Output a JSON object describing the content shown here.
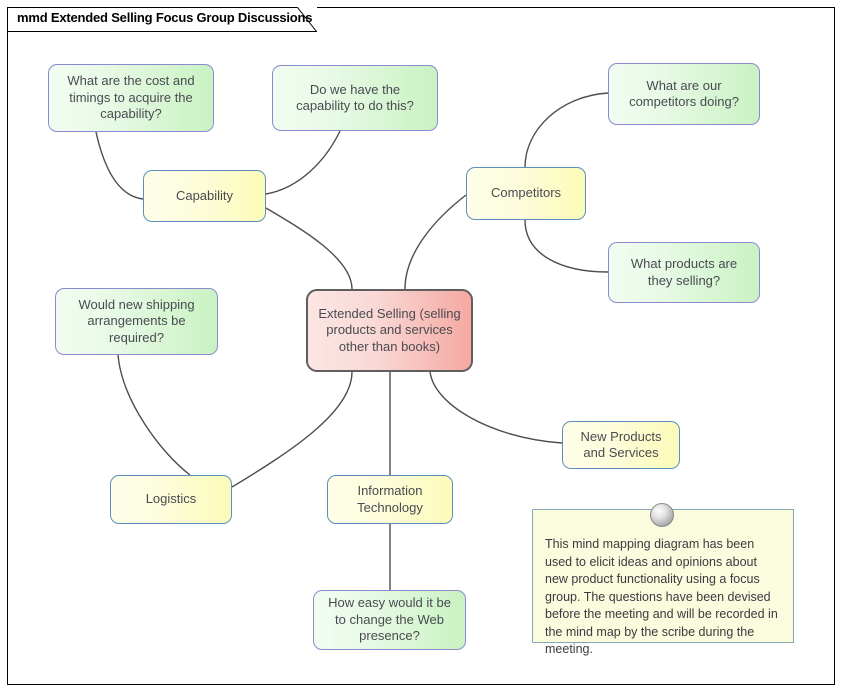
{
  "frame": {
    "title": "mmd Extended Selling Focus Group Discussions"
  },
  "central": {
    "label": "Extended Selling (selling products and services other than books)"
  },
  "branches": [
    {
      "id": "capability",
      "label": "Capability"
    },
    {
      "id": "competitors",
      "label": "Competitors"
    },
    {
      "id": "logistics",
      "label": "Logistics"
    },
    {
      "id": "information-technology",
      "label": "Information Technology"
    },
    {
      "id": "new-products-and-services",
      "label": "New Products and Services"
    }
  ],
  "questions": [
    {
      "id": "cost-and-timings",
      "label": "What are the cost and timings to acquire the capability?"
    },
    {
      "id": "have-capability",
      "label": "Do we have the capability to do this?"
    },
    {
      "id": "competitors-doing",
      "label": "What are our competitors doing?"
    },
    {
      "id": "products-selling",
      "label": "What products are they selling?"
    },
    {
      "id": "shipping-arrangements",
      "label": "Would new shipping arrangements be required?"
    },
    {
      "id": "change-web-presence",
      "label": "How easy would it be to change the Web presence?"
    }
  ],
  "note": {
    "text": "This mind mapping diagram has been used to elicit ideas and opinions about new product functionality using a focus group. The questions have been devised before the meeting and will be recorded in the mind map by the scribe during the meeting."
  },
  "colors": {
    "question_fill_light": "#f2fcf1",
    "question_fill_dark": "#c9f2c2",
    "question_border": "#8a8ad0",
    "branch_fill_light": "#fefee9",
    "branch_fill_dark": "#fbfbb9",
    "branch_border": "#5c8fc0",
    "central_fill_light": "#fbe6e4",
    "central_fill_dark": "#f5a9a2",
    "central_border": "#5f5f5f",
    "note_fill": "#fbfbdd",
    "note_border": "#8aa7b5",
    "connector": "#4d4d4d",
    "frame_border": "#000000"
  }
}
